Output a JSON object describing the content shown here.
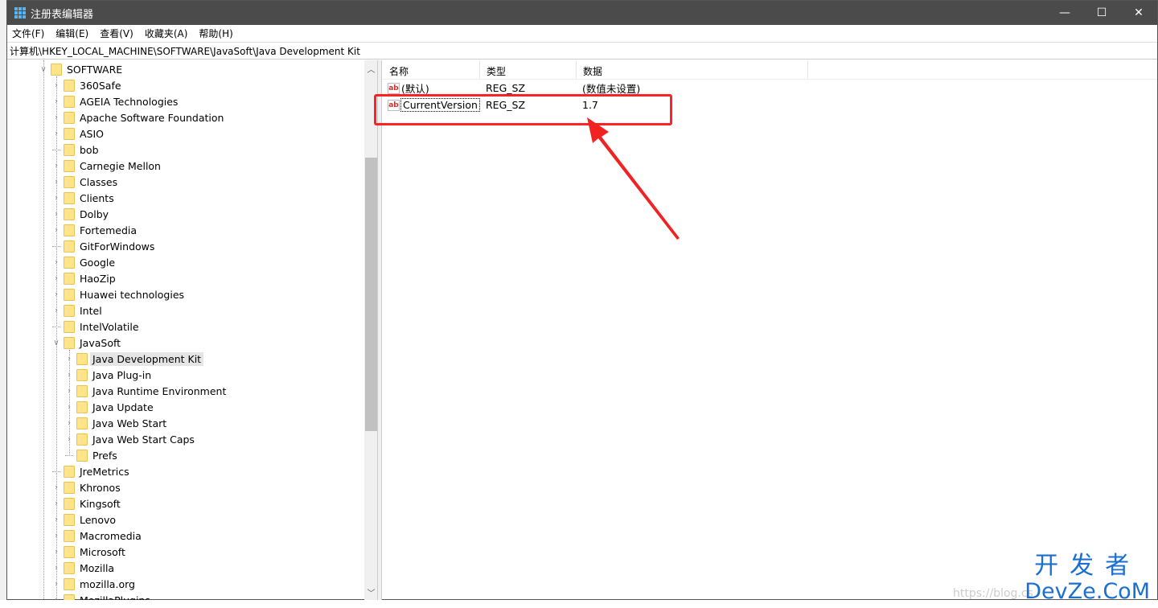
{
  "window": {
    "title": "注册表编辑器",
    "minimize": "—",
    "maximize": "☐",
    "close": "✕"
  },
  "menu": [
    "文件(F)",
    "编辑(E)",
    "查看(V)",
    "收藏夹(A)",
    "帮助(H)"
  ],
  "address": "计算机\\HKEY_LOCAL_MACHINE\\SOFTWARE\\JavaSoft\\Java Development Kit",
  "tree": [
    {
      "label": "SOFTWARE",
      "level": 1,
      "state": "expanded"
    },
    {
      "label": "360Safe",
      "level": 2,
      "state": "collapsed"
    },
    {
      "label": "AGEIA Technologies",
      "level": 2,
      "state": "collapsed"
    },
    {
      "label": "Apache Software Foundation",
      "level": 2,
      "state": "collapsed"
    },
    {
      "label": "ASIO",
      "level": 2,
      "state": "collapsed"
    },
    {
      "label": "bob",
      "level": 2,
      "state": "leaf"
    },
    {
      "label": "Carnegie Mellon",
      "level": 2,
      "state": "collapsed"
    },
    {
      "label": "Classes",
      "level": 2,
      "state": "collapsed"
    },
    {
      "label": "Clients",
      "level": 2,
      "state": "collapsed"
    },
    {
      "label": "Dolby",
      "level": 2,
      "state": "collapsed"
    },
    {
      "label": "Fortemedia",
      "level": 2,
      "state": "collapsed"
    },
    {
      "label": "GitForWindows",
      "level": 2,
      "state": "leaf"
    },
    {
      "label": "Google",
      "level": 2,
      "state": "collapsed"
    },
    {
      "label": "HaoZip",
      "level": 2,
      "state": "collapsed"
    },
    {
      "label": "Huawei technologies",
      "level": 2,
      "state": "collapsed"
    },
    {
      "label": "Intel",
      "level": 2,
      "state": "collapsed"
    },
    {
      "label": "IntelVolatile",
      "level": 2,
      "state": "leaf"
    },
    {
      "label": "JavaSoft",
      "level": 2,
      "state": "expanded"
    },
    {
      "label": "Java Development Kit",
      "level": 3,
      "state": "collapsed",
      "selected": true
    },
    {
      "label": "Java Plug-in",
      "level": 3,
      "state": "collapsed"
    },
    {
      "label": "Java Runtime Environment",
      "level": 3,
      "state": "collapsed"
    },
    {
      "label": "Java Update",
      "level": 3,
      "state": "collapsed"
    },
    {
      "label": "Java Web Start",
      "level": 3,
      "state": "collapsed"
    },
    {
      "label": "Java Web Start Caps",
      "level": 3,
      "state": "collapsed"
    },
    {
      "label": "Prefs",
      "level": 3,
      "state": "leaf"
    },
    {
      "label": "JreMetrics",
      "level": 2,
      "state": "leaf"
    },
    {
      "label": "Khronos",
      "level": 2,
      "state": "collapsed"
    },
    {
      "label": "Kingsoft",
      "level": 2,
      "state": "collapsed"
    },
    {
      "label": "Lenovo",
      "level": 2,
      "state": "collapsed"
    },
    {
      "label": "Macromedia",
      "level": 2,
      "state": "collapsed"
    },
    {
      "label": "Microsoft",
      "level": 2,
      "state": "collapsed"
    },
    {
      "label": "Mozilla",
      "level": 2,
      "state": "collapsed"
    },
    {
      "label": "mozilla.org",
      "level": 2,
      "state": "collapsed"
    },
    {
      "label": "MozillaPlugins",
      "level": 2,
      "state": "collapsed"
    }
  ],
  "list": {
    "headers": [
      "名称",
      "类型",
      "数据"
    ],
    "rows": [
      {
        "name": "(默认)",
        "type": "REG_SZ",
        "data": "(数值未设置)"
      },
      {
        "name": "CurrentVersion",
        "type": "REG_SZ",
        "data": "1.7"
      }
    ]
  },
  "annotation": {
    "color": "#f22222"
  },
  "watermark": {
    "cn": "开发者",
    "en": "DevZe.CoM",
    "url": "https://blog.cs"
  }
}
